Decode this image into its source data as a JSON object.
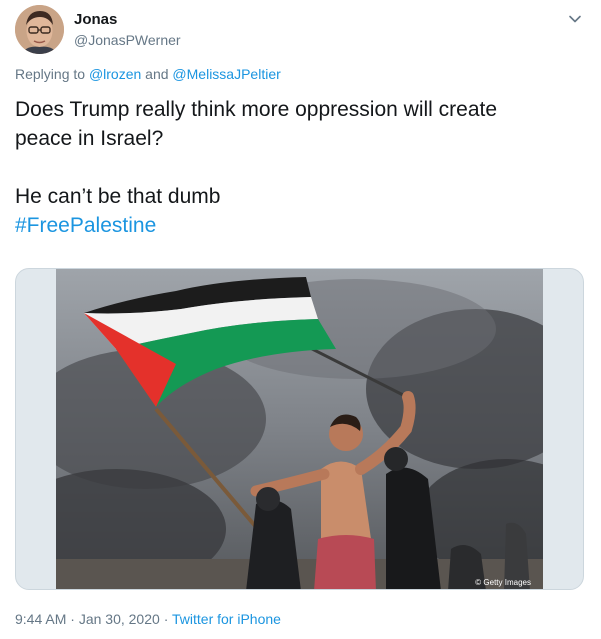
{
  "author": {
    "display_name": "Jonas",
    "handle": "@JonasPWerner"
  },
  "reply": {
    "prefix": "Replying to",
    "mention_1": "@lrozen",
    "connector": "and",
    "mention_2": "@MelissaJPeltier"
  },
  "tweet": {
    "line_1": "Does Trump really think more oppression will create",
    "line_2": "peace in Israel?",
    "line_3": "He can’t be that dumb",
    "hashtag": "#FreePalestine"
  },
  "media": {
    "credit": "© Getty Images",
    "flag_colors": {
      "black": "#1c1c1c",
      "white": "#f2f2f2",
      "green": "#149954",
      "red": "#e4312b"
    },
    "sky_color": "#8f9399"
  },
  "footer": {
    "time": "9:44 AM",
    "separator": "·",
    "date": "Jan 30, 2020",
    "source": "Twitter for iPhone"
  },
  "icons": {
    "caret": "chevron-down-icon"
  },
  "colors": {
    "link": "#1b95e0",
    "secondary_text": "#657786",
    "primary_text": "#14171a",
    "border": "#ccd6dd"
  }
}
